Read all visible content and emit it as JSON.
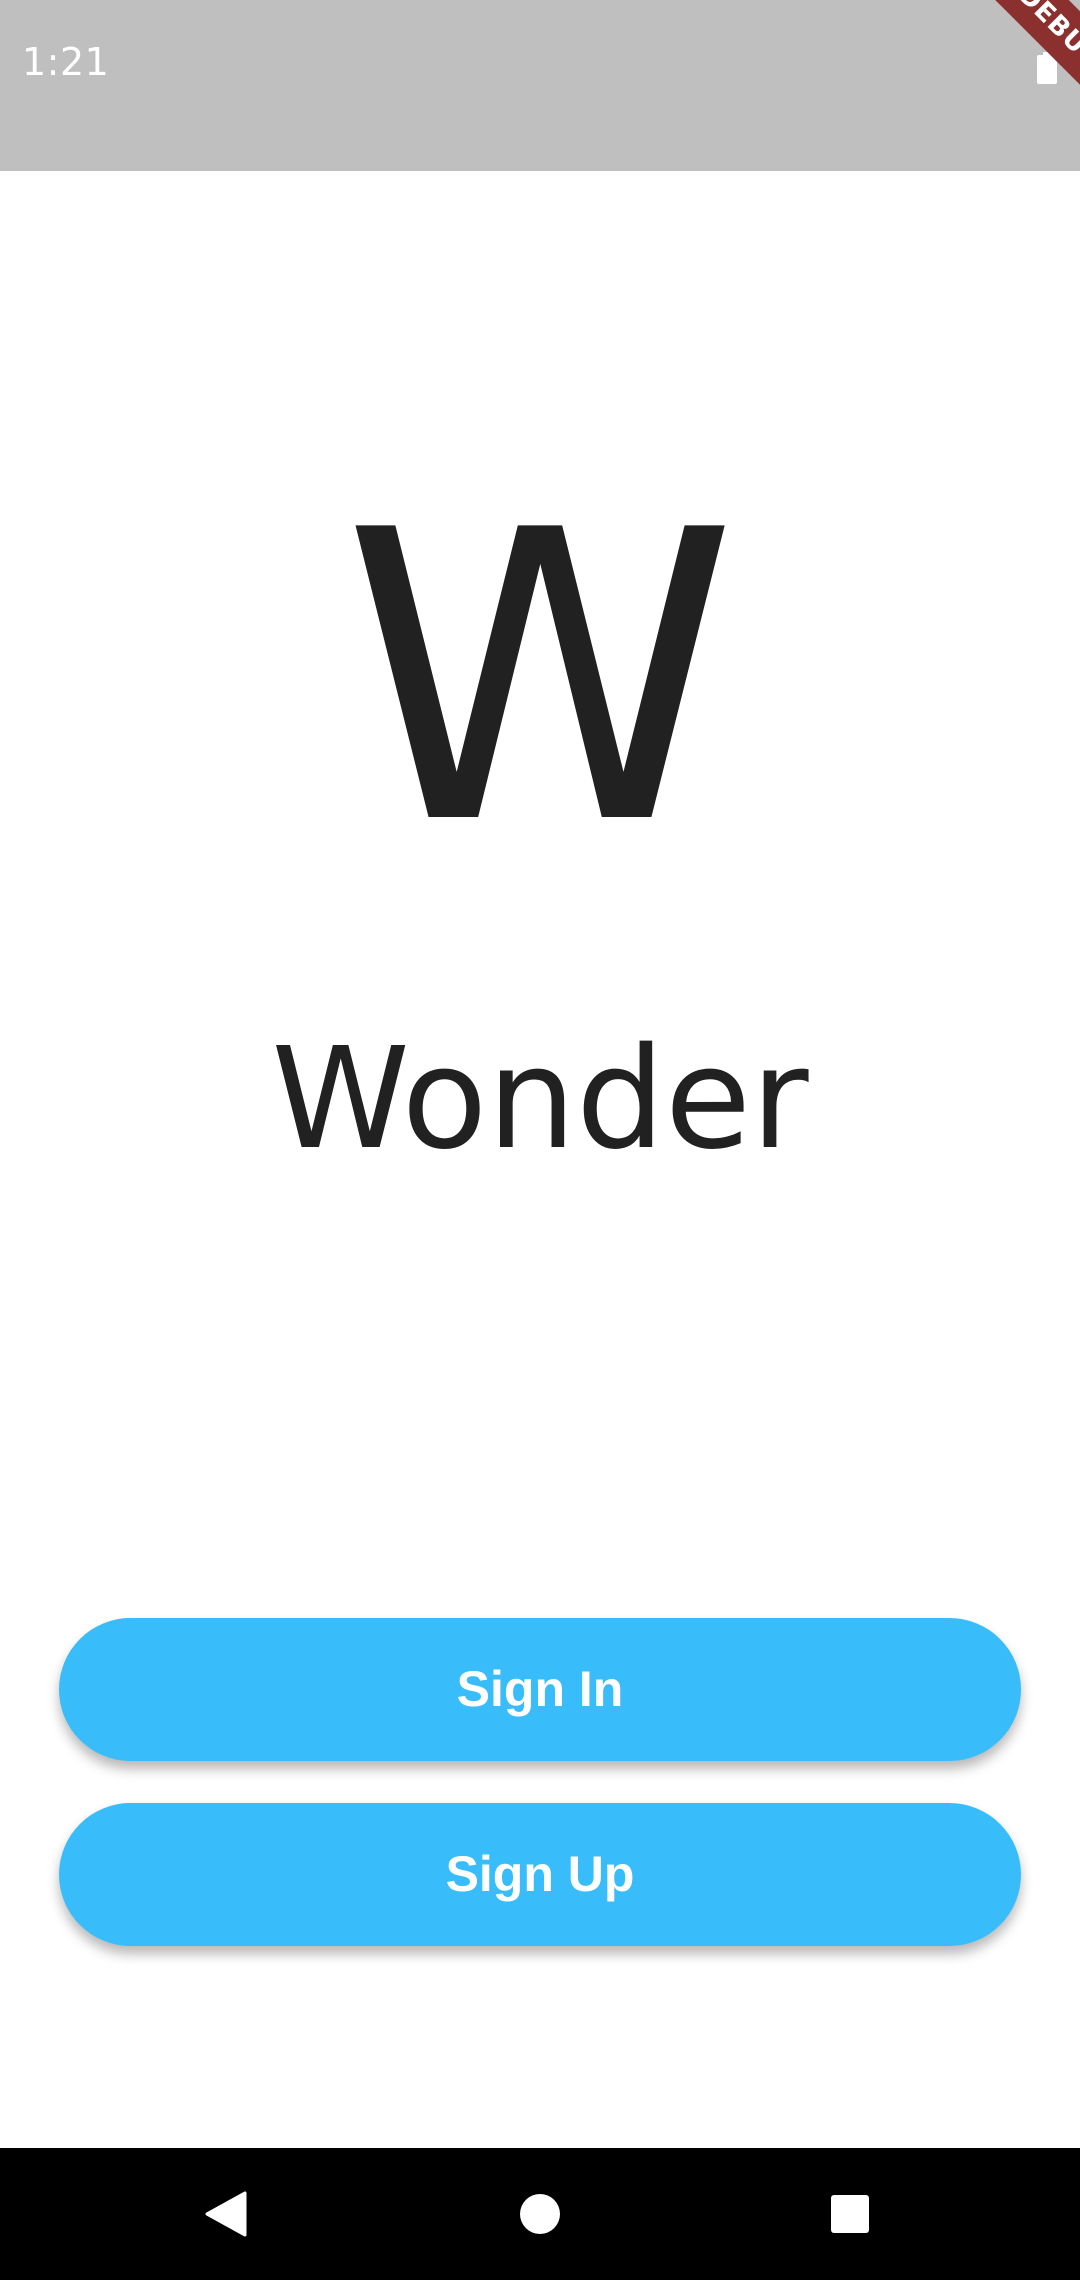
{
  "status_bar": {
    "time": "1:21",
    "battery_icon": "battery-full-icon",
    "debug_banner": "DEBUG",
    "background": "#bfbfbf"
  },
  "brand": {
    "logo_letter": "W",
    "app_name": "Wonder",
    "text_color": "#212121"
  },
  "actions": {
    "sign_in_label": "Sign In",
    "sign_up_label": "Sign Up",
    "button_color": "#38bdfa"
  },
  "nav_bar": {
    "back_icon": "back-triangle-icon",
    "home_icon": "home-circle-icon",
    "recents_icon": "recents-square-icon"
  }
}
